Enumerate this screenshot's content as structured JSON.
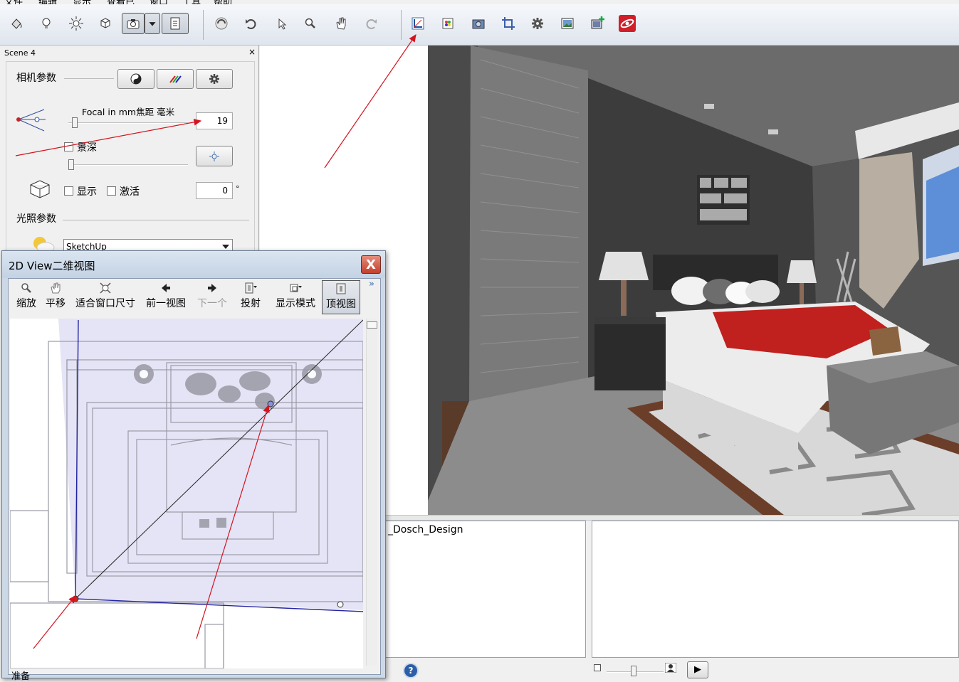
{
  "menubar": {
    "items": [
      "文件",
      "编辑",
      "显示",
      "查看已",
      "窗口",
      "工具",
      "帮助"
    ]
  },
  "toolbar": {
    "icons": [
      "paint-bucket-icon",
      "light-bulb-icon",
      "sun-icon",
      "cube-icon",
      "camera-icon",
      "dropdown-arrow-icon",
      "document-icon",
      "orbit-icon",
      "undo-icon",
      "pointer-icon",
      "zoom-icon",
      "hand-pan-icon",
      "redo-icon",
      "2d-view-icon",
      "color-palette-icon",
      "camera-render-icon",
      "crop-icon",
      "settings-gear-icon",
      "image-frame-icon",
      "add-scene-icon",
      "plugin-logo-icon"
    ]
  },
  "scene_panel": {
    "title": "Scene 4",
    "close": "×",
    "camera_section": "相机参数",
    "focal_label": "Focal in mm焦距 毫米",
    "focal_value": "19",
    "dof_label": "景深",
    "show_label": "显示",
    "activate_label": "激活",
    "angle_value": "0",
    "angle_unit": "°",
    "lighting_section": "光照参数",
    "lighting_preset": "SketchUp"
  },
  "dialog_2d": {
    "title": "2D View二维视图",
    "close": "X",
    "toolbar": [
      {
        "label": "缩放",
        "icon": "zoom-icon"
      },
      {
        "label": "平移",
        "icon": "hand-pan-icon"
      },
      {
        "label": "适合窗口尺寸",
        "icon": "fit-window-icon"
      },
      {
        "label": "前一视图",
        "icon": "arrow-left-icon"
      },
      {
        "label": "下一个",
        "icon": "arrow-right-icon"
      },
      {
        "label": "投射",
        "icon": "projection-icon"
      },
      {
        "label": "显示模式",
        "icon": "display-mode-icon"
      },
      {
        "label": "顶视图",
        "icon": "top-view-icon"
      }
    ],
    "more": "»",
    "status": "准备"
  },
  "bottom": {
    "material_name": "_Dosch_Design",
    "help": "?",
    "play": "▶"
  },
  "colors": {
    "arrow": "#d4141e",
    "camera_line": "#1c1c8a",
    "plan_fill": "#dfe0f5"
  }
}
